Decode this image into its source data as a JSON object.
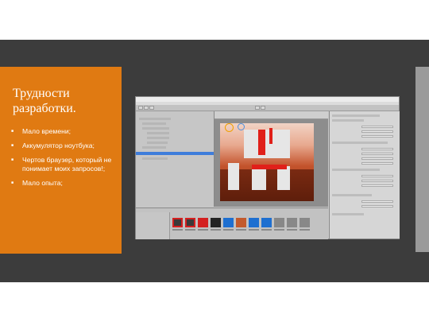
{
  "slide": {
    "title": "Трудности разработки.",
    "bullets": [
      "Мало времени;",
      "Аккумулятор ноутбука;",
      "Чертов браузер, который не понимает моих запросов!;",
      "Мало опыта;"
    ],
    "colors": {
      "accent": "#e07a12",
      "background": "#3c3c3c",
      "text": "#ffffff"
    }
  },
  "editor": {
    "panels": [
      "Hierarchy",
      "Scene",
      "Inspector",
      "Project",
      "Console"
    ],
    "project_folder": "Prefabs",
    "icons": [
      "move-tool-icon",
      "rotate-tool-icon",
      "scale-tool-icon",
      "play-icon",
      "pause-icon"
    ]
  }
}
